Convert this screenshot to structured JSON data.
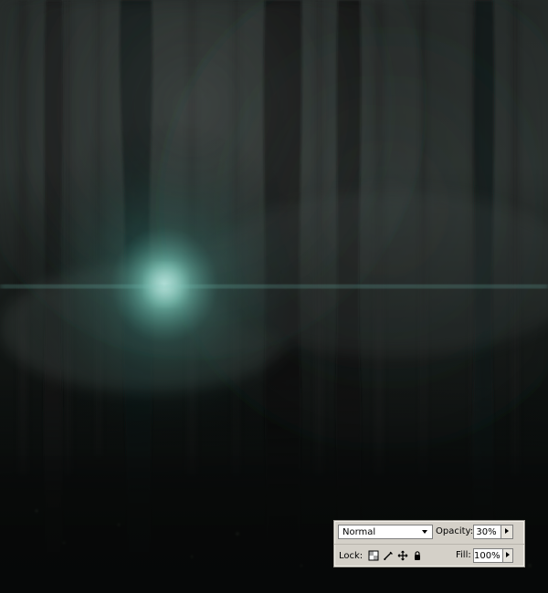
{
  "canvas": {
    "title": ""
  },
  "layers_panel": {
    "blend_mode": {
      "label": "Normal"
    },
    "opacity": {
      "label": "Opacity:",
      "value": "30%"
    },
    "lock": {
      "label": "Lock:"
    },
    "fill": {
      "label": "Fill:",
      "value": "100%"
    },
    "icons": {
      "lock_transparent": "lock-transparent-pixels-icon",
      "lock_image": "lock-image-pixels-icon",
      "lock_position": "lock-position-icon",
      "lock_all": "lock-all-icon",
      "dropdown": "chevron-down-icon",
      "stepper": "triangle-right-icon"
    }
  }
}
